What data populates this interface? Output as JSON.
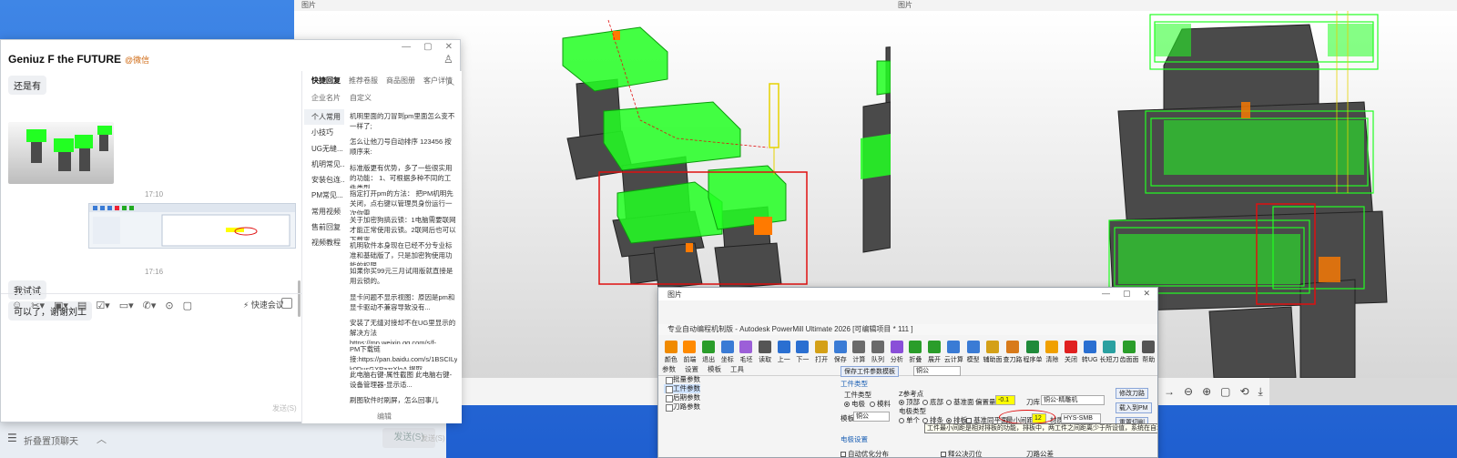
{
  "chat": {
    "title": "Geniuz F the FUTURE",
    "verified_label": "@微信",
    "messages": [
      {
        "text": "还是有"
      },
      {
        "text": "17:10"
      },
      {
        "text": "17:16"
      },
      {
        "text": "我试试"
      },
      {
        "text": "可以了，谢谢刘工"
      }
    ],
    "composer": {
      "quick_meeting": "快速会议",
      "send_hint": "发送(S)"
    }
  },
  "quick_reply": {
    "tabs": [
      "快捷回复",
      "推荐卷服",
      "商品图册",
      "客户详情"
    ],
    "subtabs": [
      "企业名片",
      "自定义"
    ],
    "categories": [
      "个人常用",
      "小技巧",
      "UG无缝...",
      "机明常见...",
      "安装包连...",
      "PM常见...",
      "常用视频",
      "售前回复",
      "视频教程"
    ],
    "items": [
      "机明里面的刀冒到pm里面怎么变不一样了;",
      "怎么让他刀号自动排序 123456 按顺序来:",
      "标准版更有优势，多了一些很实用的功能： 1、可根据多种不同的工件类型...",
      "指定打开pm的方法： 把PM机明先关闭，点右键以管理员身份运行一次你需...",
      "关于加密狗搞云锁：1电脑需要联网才能正常使用云锁。2联网后也可以下载离...",
      "机明软件本身现在已经不分专业标准和基础版了，只是加密狗使用功能的权限...",
      "如果你买99元三月试用版就直接是用云锁的。",
      "显卡问题不显示视图：原因是pm和显卡驱动不兼容导致没有...",
      "安装了无缝对接却不在UG里显示的解决方法 https://mp.weixin.qq.com/s/f-...",
      "PM下载链接:https://pan.baidu.com/s/1BSCILy-k0DusGXPazrXloA 提取...",
      "此电脑右键-属性截图 此电脑右键-设备管理器-显示适...",
      "刷图软件时刷屏，怎么回事儿"
    ],
    "edit_label": "编辑",
    "send_label": "发送(S)"
  },
  "viewer_left": {
    "title": "图片"
  },
  "viewer_right": {
    "title": "图片"
  },
  "taskbar": {
    "label": "折叠置顶聊天",
    "send_label": "发送(S)"
  },
  "powermill": {
    "caption": "图片",
    "window_title": "专业自动编程机制版 - Autodesk PowerMill Ultimate 2026  [可编辑项目 * 111 ]",
    "ribbon": [
      "颜色",
      "前端",
      "退出",
      "坐标",
      "毛坯",
      "读取",
      "上一",
      "下一",
      "打开",
      "保存",
      "计算",
      "队列",
      "分析",
      "折叠",
      "展开",
      "云计算",
      "模型",
      "辅助面",
      "查刀路",
      "程序单",
      "清除",
      "关闭",
      "转UG",
      "长短刀",
      "齿面面",
      "帮助"
    ],
    "tree_tabs": [
      "参数",
      "设置",
      "模板",
      "工具"
    ],
    "tree": [
      "批量参数",
      "工件参数",
      "后期参数",
      "刀路参数"
    ],
    "template_button": "保存工件参数模板",
    "template_value": "铜公",
    "section_workpiece": "工件类型",
    "workpiece_types": [
      "电极",
      "模料"
    ],
    "z_ref_label": "Z参考点",
    "z_ref_options": [
      "顶部",
      "底部",
      "基准面"
    ],
    "offset_label": "偏置量",
    "offset_value": "-0.1",
    "tool_lib_label": "刀库",
    "tool_lib_value": "铜公-精雕机",
    "modify_tool": "修改刀路",
    "load_pm": "载入到PM",
    "reset_cut": "重置切削",
    "template_label": "模板",
    "template_value2": "铜公",
    "electrode_type_label": "电极类型",
    "electrode_types": [
      "单个",
      "排条",
      "排板"
    ],
    "base_plane_label": "基准同平面",
    "min_gap_label": "最小间距",
    "min_gap_value": "12",
    "material_label": "材质",
    "material_value": "HYS-SMB",
    "electrode_settings": "电极设置",
    "auto_optimize": "自动优化分布",
    "tooltip": "工件最小间距是相对排板的功能，排板中，两工件之间距离少于所设值，系统在自动生成毛坯时，数",
    "tolerance_label": "刀路公差",
    "chamfer_label": "释公决刃位"
  },
  "colors": {
    "toolpath_green": "#22ff22",
    "electrode_gray": "#4a4a4a",
    "highlight_orange": "#ff7a00",
    "annotation_red": "#e01010"
  }
}
